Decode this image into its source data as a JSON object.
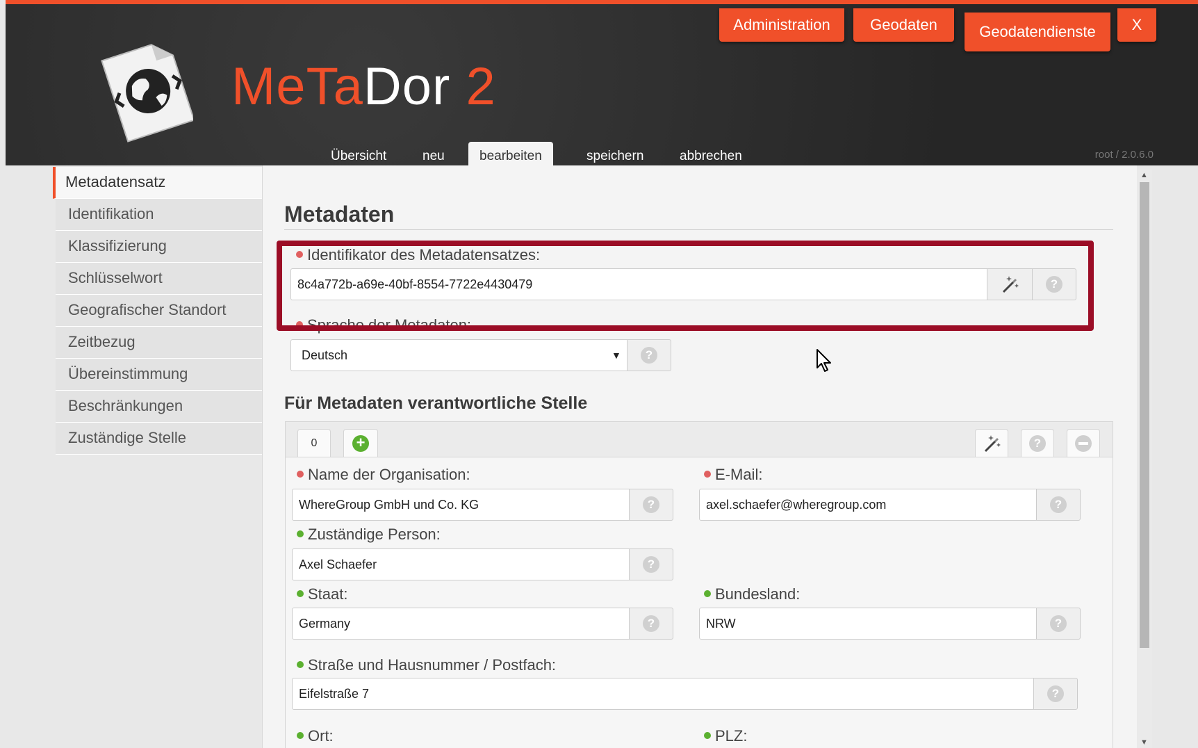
{
  "header": {
    "app_title_part1": "MeTa",
    "app_title_part2": "Dor",
    "app_title_part3": "2",
    "top_buttons": {
      "administration": "Administration",
      "geodaten": "Geodaten",
      "geodatendienste": "Geodatendienste",
      "close": "X"
    },
    "nav_tabs": [
      "Übersicht",
      "neu",
      "bearbeiten",
      "speichern",
      "abbrechen"
    ],
    "active_nav_tab": "bearbeiten",
    "version": "root / 2.0.6.0"
  },
  "sidebar": {
    "items": [
      "Metadatensatz",
      "Identifikation",
      "Klassifizierung",
      "Schlüsselwort",
      "Geografischer Standort",
      "Zeitbezug",
      "Übereinstimmung",
      "Beschränkungen",
      "Zuständige Stelle"
    ],
    "active_item": "Metadatensatz"
  },
  "main": {
    "page_title": "Metadaten",
    "identifier": {
      "label": "Identifikator des Metadatensatzes:",
      "value": "8c4a772b-a69e-40bf-8554-7722e4430479"
    },
    "language": {
      "label": "Sprache der Metadaten:",
      "value": "Deutsch"
    },
    "responsible_section_title": "Für Metadaten verantwortliche Stelle",
    "responsible_tabs": [
      "0"
    ],
    "fields": {
      "org_name": {
        "label": "Name der Organisation:",
        "value": "WhereGroup GmbH und Co. KG"
      },
      "email": {
        "label": "E-Mail:",
        "value": "axel.schaefer@wheregroup.com"
      },
      "person": {
        "label": "Zuständige Person:",
        "value": "Axel Schaefer"
      },
      "country": {
        "label": "Staat:",
        "value": "Germany"
      },
      "state": {
        "label": "Bundesland:",
        "value": "NRW"
      },
      "street": {
        "label": "Straße und Hausnummer / Postfach:",
        "value": "Eifelstraße 7"
      },
      "city": {
        "label": "Ort:"
      },
      "zip": {
        "label": "PLZ:"
      }
    },
    "help_glyph": "?"
  },
  "colors": {
    "accent": "#f0502a",
    "highlight": "#9b0d26",
    "required_dot": "#e06060",
    "optional_dot": "#5bb030",
    "header_bg": "#2b2b2b"
  },
  "icons": [
    "globe-document-icon",
    "magic-wand-icon",
    "help-icon",
    "add-icon",
    "remove-icon",
    "dropdown-arrow-icon",
    "mouse-cursor-icon"
  ]
}
